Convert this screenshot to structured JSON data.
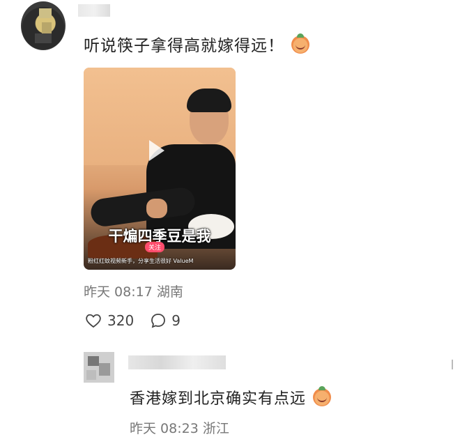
{
  "post": {
    "text": "听说筷子拿得高就嫁得远！",
    "emoji": "pig-face-emoji",
    "video": {
      "caption": "干煸四季豆是我",
      "tag": "关注",
      "subtitle": "粉红红蚊视频新手，分享生活很好 ValueM"
    },
    "time": "昨天 08:17 湖南",
    "likes": "320",
    "comments": "9"
  },
  "reply": {
    "text": "香港嫁到北京确实有点远",
    "emoji": "peach-face-emoji",
    "time": "昨天 08:23 浙江"
  },
  "icons": {
    "like": "heart-outline-icon",
    "comment": "comment-bubble-icon",
    "play": "play-icon"
  },
  "colors": {
    "meta_text": "#777777",
    "tag_bg": "#ff4d6d"
  }
}
